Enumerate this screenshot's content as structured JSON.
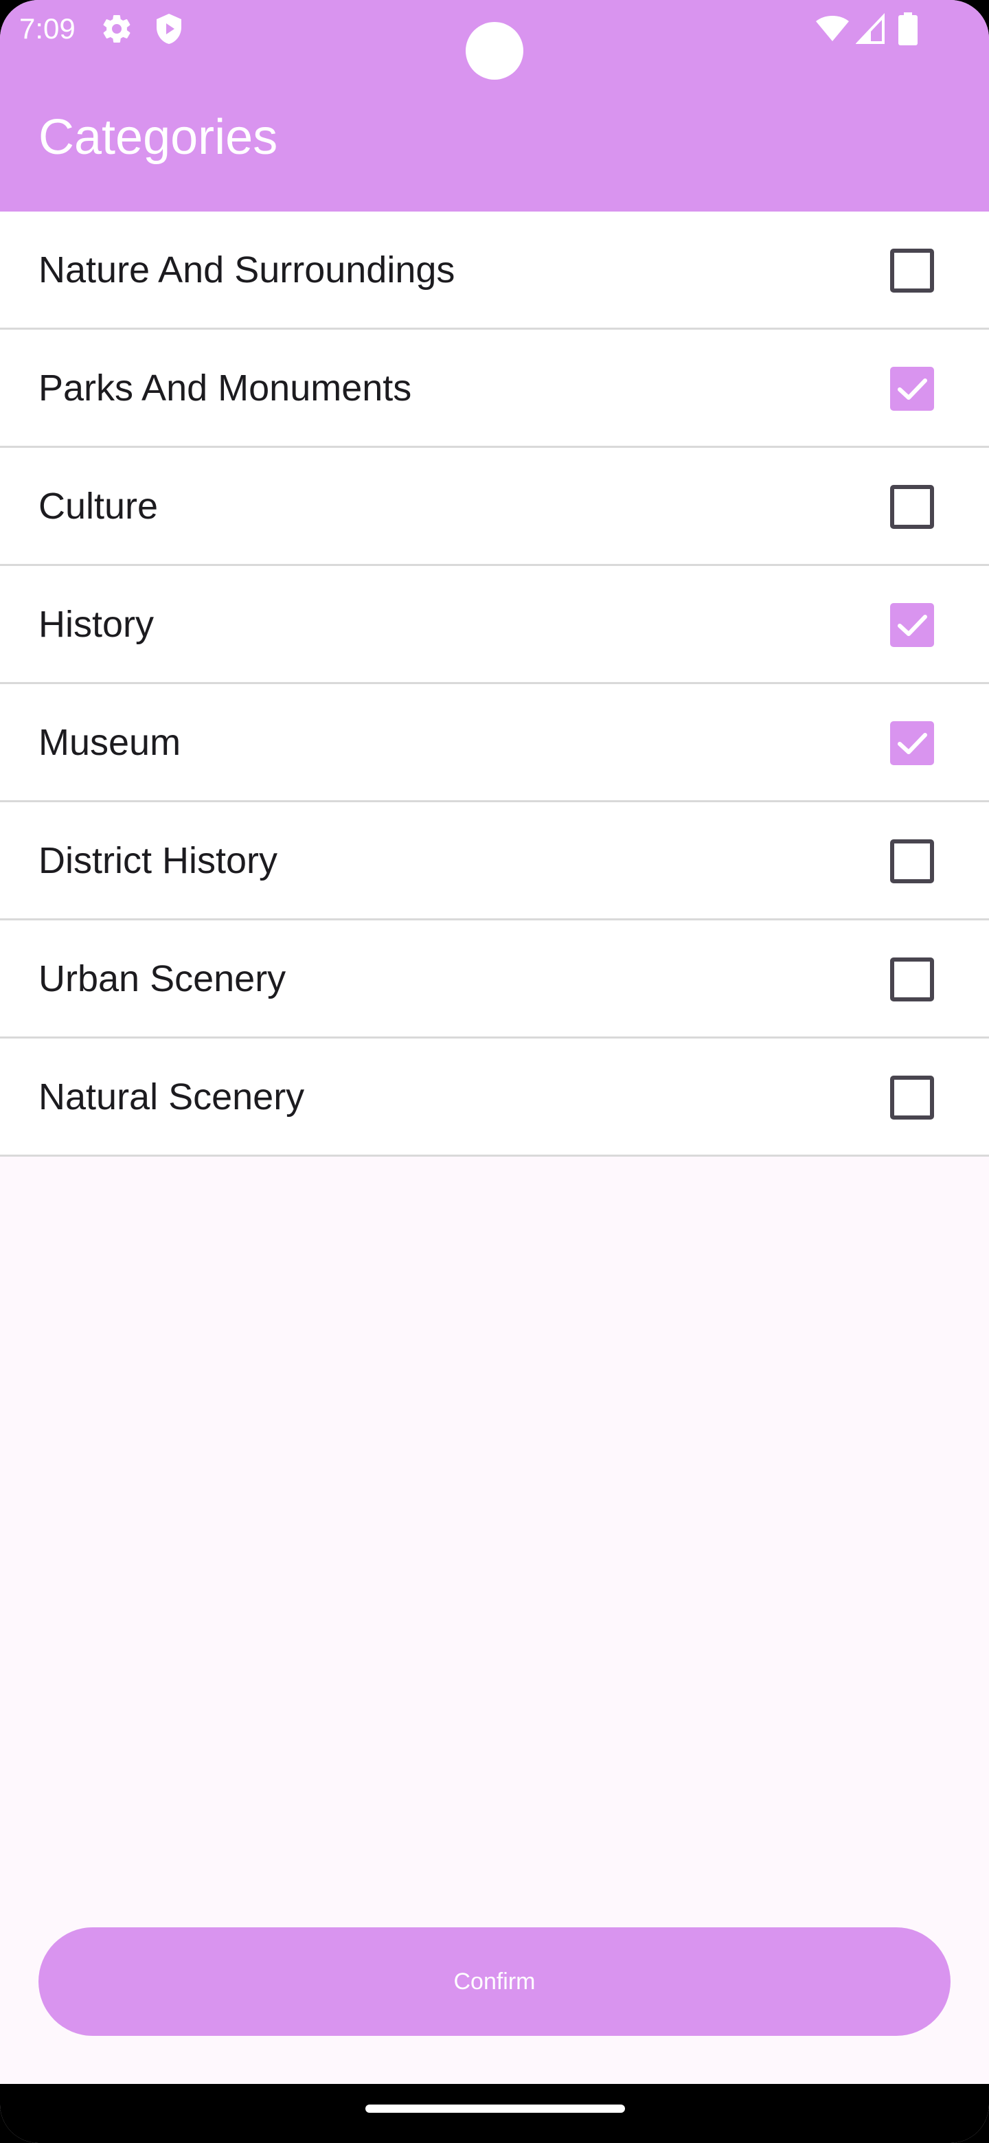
{
  "status_bar": {
    "time": "7:09",
    "icons": [
      "gear-icon",
      "shield-icon",
      "wifi-icon",
      "signal-icon",
      "battery-icon"
    ]
  },
  "header": {
    "title": "Categories"
  },
  "categories": [
    {
      "label": "Nature And Surroundings",
      "checked": false
    },
    {
      "label": "Parks And Monuments",
      "checked": true
    },
    {
      "label": "Culture",
      "checked": false
    },
    {
      "label": "History",
      "checked": true
    },
    {
      "label": "Museum",
      "checked": true
    },
    {
      "label": "District History",
      "checked": false
    },
    {
      "label": "Urban Scenery",
      "checked": false
    },
    {
      "label": "Natural Scenery",
      "checked": false
    }
  ],
  "confirm": {
    "label": "Confirm"
  },
  "colors": {
    "accent": "#d994ef",
    "background": "#fef8fd",
    "checkbox_border": "#49454f"
  }
}
